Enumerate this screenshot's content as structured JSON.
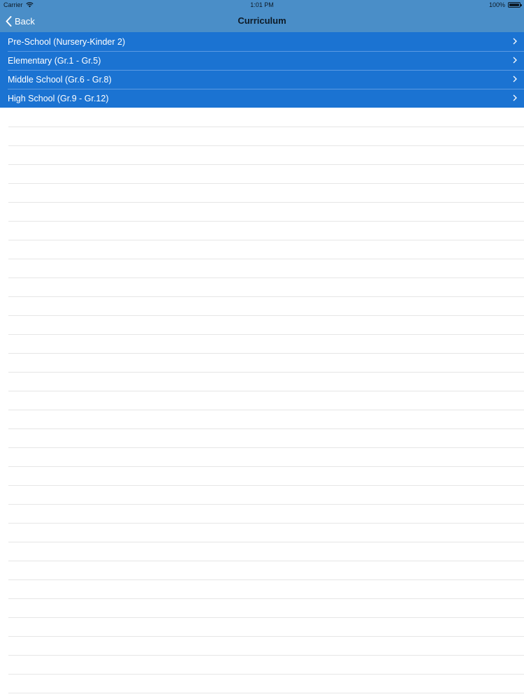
{
  "status_bar": {
    "carrier": "Carrier",
    "time": "1:01 PM",
    "battery": "100%"
  },
  "nav": {
    "back_label": "Back",
    "title": "Curriculum"
  },
  "menu": {
    "items": [
      {
        "label": "Pre-School (Nursery-Kinder 2)"
      },
      {
        "label": "Elementary (Gr.1 - Gr.5)"
      },
      {
        "label": "Middle School (Gr.6 - Gr.8)"
      },
      {
        "label": "High School (Gr.9 - Gr.12)"
      }
    ]
  },
  "colors": {
    "nav_background": "#4a8ec8",
    "row_background": "#1b73d2",
    "row_text": "#ffffff"
  }
}
